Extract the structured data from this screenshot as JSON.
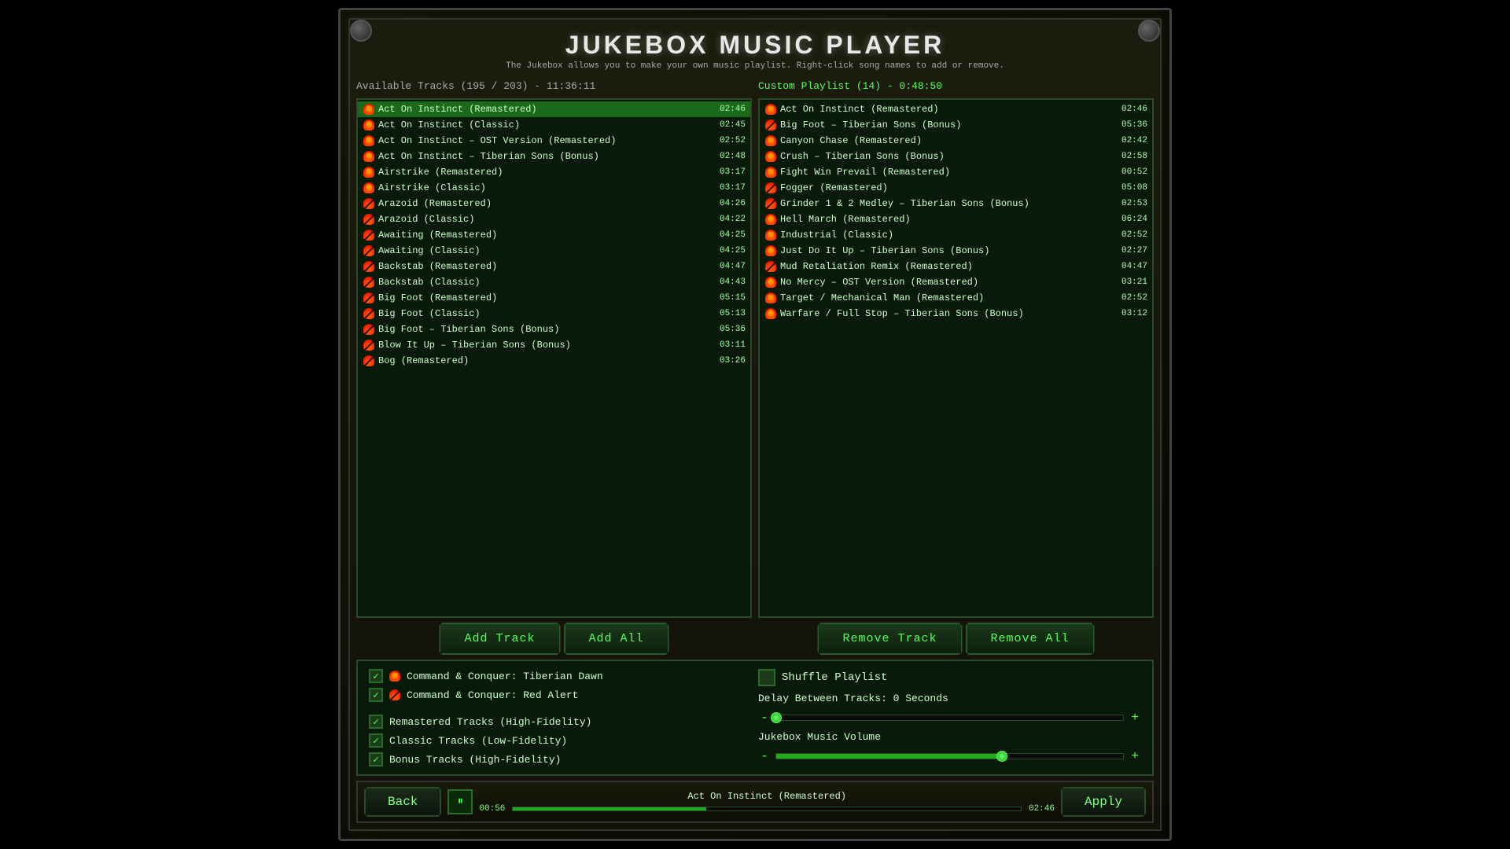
{
  "app": {
    "title": "JUKEBOX MUSIC PLAYER",
    "subtitle": "The Jukebox allows you to make your own music playlist. Right-click song names to add or remove."
  },
  "available_tracks": {
    "label": "Available Tracks (195 / 203) - 11:36:11",
    "items": [
      {
        "name": "Act On Instinct (Remastered)",
        "duration": "02:46",
        "icon": "fire",
        "selected": true
      },
      {
        "name": "Act On Instinct (Classic)",
        "duration": "02:45",
        "icon": "fire",
        "selected": false
      },
      {
        "name": "Act On Instinct – OST Version (Remastered)",
        "duration": "02:52",
        "icon": "fire",
        "selected": false
      },
      {
        "name": "Act On Instinct – Tiberian Sons (Bonus)",
        "duration": "02:48",
        "icon": "fire",
        "selected": false
      },
      {
        "name": "Airstrike (Remastered)",
        "duration": "03:17",
        "icon": "fire",
        "selected": false
      },
      {
        "name": "Airstrike (Classic)",
        "duration": "03:17",
        "icon": "fire",
        "selected": false
      },
      {
        "name": "Arazoid (Remastered)",
        "duration": "04:26",
        "icon": "slash",
        "selected": false
      },
      {
        "name": "Arazoid (Classic)",
        "duration": "04:22",
        "icon": "slash",
        "selected": false
      },
      {
        "name": "Awaiting (Remastered)",
        "duration": "04:25",
        "icon": "slash",
        "selected": false
      },
      {
        "name": "Awaiting (Classic)",
        "duration": "04:25",
        "icon": "slash",
        "selected": false
      },
      {
        "name": "Backstab (Remastered)",
        "duration": "04:47",
        "icon": "slash",
        "selected": false
      },
      {
        "name": "Backstab (Classic)",
        "duration": "04:43",
        "icon": "slash",
        "selected": false
      },
      {
        "name": "Big Foot (Remastered)",
        "duration": "05:15",
        "icon": "slash",
        "selected": false
      },
      {
        "name": "Big Foot (Classic)",
        "duration": "05:13",
        "icon": "slash",
        "selected": false
      },
      {
        "name": "Big Foot – Tiberian Sons (Bonus)",
        "duration": "05:36",
        "icon": "slash",
        "selected": false
      },
      {
        "name": "Blow It Up – Tiberian Sons (Bonus)",
        "duration": "03:11",
        "icon": "slash",
        "selected": false
      },
      {
        "name": "Bog (Remastered)",
        "duration": "03:26",
        "icon": "slash",
        "selected": false
      }
    ]
  },
  "custom_playlist": {
    "label": "Custom Playlist (14) - 0:48:50",
    "items": [
      {
        "name": "Act On Instinct (Remastered)",
        "duration": "02:46",
        "icon": "fire"
      },
      {
        "name": "Big Foot – Tiberian Sons (Bonus)",
        "duration": "05:36",
        "icon": "slash"
      },
      {
        "name": "Canyon Chase (Remastered)",
        "duration": "02:42",
        "icon": "fire"
      },
      {
        "name": "Crush – Tiberian Sons (Bonus)",
        "duration": "02:58",
        "icon": "fire"
      },
      {
        "name": "Fight Win Prevail (Remastered)",
        "duration": "00:52",
        "icon": "fire"
      },
      {
        "name": "Fogger (Remastered)",
        "duration": "05:08",
        "icon": "slash"
      },
      {
        "name": "Grinder 1 & 2 Medley – Tiberian Sons (Bonus)",
        "duration": "02:53",
        "icon": "slash"
      },
      {
        "name": "Hell March (Remastered)",
        "duration": "06:24",
        "icon": "fire"
      },
      {
        "name": "Industrial (Classic)",
        "duration": "02:52",
        "icon": "fire"
      },
      {
        "name": "Just Do It Up – Tiberian Sons (Bonus)",
        "duration": "02:27",
        "icon": "fire"
      },
      {
        "name": "Mud Retaliation Remix (Remastered)",
        "duration": "04:47",
        "icon": "slash"
      },
      {
        "name": "No Mercy – OST Version (Remastered)",
        "duration": "03:21",
        "icon": "fire"
      },
      {
        "name": "Target / Mechanical Man (Remastered)",
        "duration": "02:52",
        "icon": "fire"
      },
      {
        "name": "Warfare / Full Stop – Tiberian Sons (Bonus)",
        "duration": "03:12",
        "icon": "fire"
      }
    ]
  },
  "buttons": {
    "add_track": "Add Track",
    "add_all": "Add All",
    "remove_track": "Remove Track",
    "remove_all": "Remove All"
  },
  "options": {
    "checkbox_td": {
      "label": "Command & Conquer: Tiberian Dawn",
      "checked": true
    },
    "checkbox_ra": {
      "label": "Command & Conquer: Red Alert",
      "checked": true
    },
    "checkbox_remastered": {
      "label": "Remastered Tracks (High-Fidelity)",
      "checked": true
    },
    "checkbox_classic": {
      "label": "Classic Tracks (Low-Fidelity)",
      "checked": true
    },
    "checkbox_bonus": {
      "label": "Bonus Tracks (High-Fidelity)",
      "checked": true
    },
    "shuffle_label": "Shuffle Playlist",
    "delay_label": "Delay Between Tracks: 0 Seconds",
    "delay_value": 0,
    "volume_label": "Jukebox Music Volume",
    "volume_value": 65
  },
  "playback": {
    "back_btn": "Back",
    "apply_btn": "Apply",
    "now_playing": "Act On Instinct (Remastered)",
    "current_time": "00:56",
    "total_time": "02:46",
    "progress_pct": 38
  }
}
